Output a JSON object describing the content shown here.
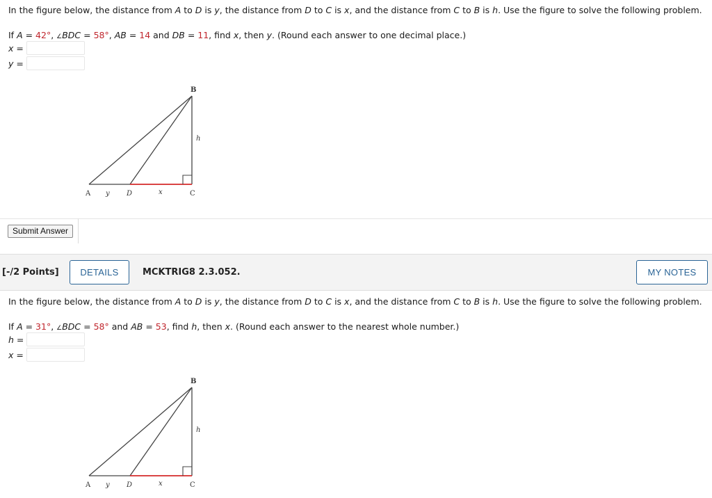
{
  "problems": [
    {
      "intro": {
        "p1": "In the figure below, the distance from ",
        "A": "A",
        "p2": " to ",
        "D": "D",
        "p3": " is ",
        "y": "y",
        "p4": ", the distance from ",
        "D2": "D",
        "p5": " to ",
        "C": "C",
        "p6": " is ",
        "x": "x",
        "p7": ", and the distance from ",
        "C2": "C",
        "p8": " to ",
        "B": "B",
        "p9": " is ",
        "h": "h",
        "p10": ". Use the figure to solve the following problem."
      },
      "given": {
        "if": "If ",
        "A": "A",
        "eq1": " = ",
        "angleA": "42°",
        "sep1": ", ",
        "angleSym": "∠",
        "BDC": "BDC",
        "eq2": " = ",
        "angleBDC": "58°",
        "sep2": ", ",
        "AB": "AB",
        "eq3": " = ",
        "AB_val": "14",
        "and": " and ",
        "DB": "DB",
        "eq4": " = ",
        "DB_val": "11",
        "find1": ", find ",
        "x": "x",
        "then": ", then ",
        "y": "y",
        "tail": ". (Round each answer to one decimal place.)"
      },
      "answers": [
        {
          "var": "x",
          "eq": " =",
          "value": ""
        },
        {
          "var": "y",
          "eq": " =",
          "value": ""
        }
      ],
      "figure_labels": {
        "A": "A",
        "y": "y",
        "D": "D",
        "x": "x",
        "C": "C",
        "B": "B",
        "h": "h"
      },
      "submit_label": "Submit Answer"
    },
    {
      "points": "[-/2 Points]",
      "details_label": "DETAILS",
      "question_id": "MCKTRIG8 2.3.052.",
      "notes_label": "MY NOTES",
      "intro": {
        "p1": "In the figure below, the distance from ",
        "A": "A",
        "p2": " to ",
        "D": "D",
        "p3": " is ",
        "y": "y",
        "p4": ", the distance from ",
        "D2": "D",
        "p5": " to ",
        "C": "C",
        "p6": " is ",
        "x": "x",
        "p7": ", and the distance from ",
        "C2": "C",
        "p8": " to ",
        "B": "B",
        "p9": " is ",
        "h": "h",
        "p10": ". Use the figure to solve the following problem."
      },
      "given": {
        "if": "If ",
        "A": "A",
        "eq1": " = ",
        "angleA": "31°",
        "sep1": ", ",
        "angleSym": "∠",
        "BDC": "BDC",
        "eq2": " = ",
        "angleBDC": "58°",
        "and": " and ",
        "AB": "AB",
        "eq3": " = ",
        "AB_val": "53",
        "find1": ", find ",
        "h": "h",
        "then": ", then ",
        "x": "x",
        "tail": ". (Round each answer to the nearest whole number.)"
      },
      "answers": [
        {
          "var": "h",
          "eq": " =",
          "value": ""
        },
        {
          "var": "x",
          "eq": " =",
          "value": ""
        }
      ],
      "figure_labels": {
        "A": "A",
        "y": "y",
        "D": "D",
        "x": "x",
        "C": "C",
        "B": "B",
        "h": "h"
      }
    }
  ],
  "colors": {
    "given_value": "#c0262d",
    "link_blue": "#2a6496",
    "segment_red": "#d42a2a"
  }
}
